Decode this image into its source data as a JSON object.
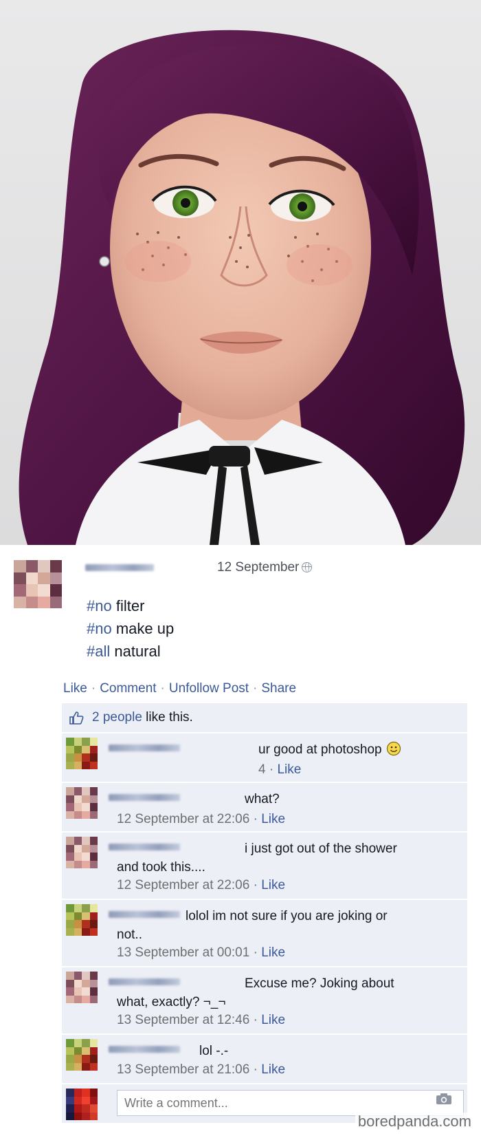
{
  "post": {
    "timestamp": "12 September",
    "lines": [
      {
        "tag": "#no",
        "rest": " filter"
      },
      {
        "tag": "#no",
        "rest": " make up"
      },
      {
        "tag": "#all",
        "rest": " natural"
      }
    ],
    "actions": {
      "like": "Like",
      "comment": "Comment",
      "unfollow": "Unfollow Post",
      "share": "Share",
      "separator": "·"
    },
    "likes": {
      "count_text": "2 people",
      "rest": " like this."
    }
  },
  "comments": [
    {
      "text": "ur good at photoshop",
      "meta_prefix": "4 · ",
      "like": "Like",
      "has_smile": true
    },
    {
      "text": "what?",
      "meta_prefix": "12 September at 22:06 · ",
      "like": "Like"
    },
    {
      "text": "i just got out of the shower",
      "text2": "and took this....",
      "meta_prefix": "12 September at 22:06 · ",
      "like": "Like"
    },
    {
      "text": "lolol im not sure if you are joking or",
      "text2": "not..",
      "meta_prefix": "13 September at 00:01 · ",
      "like": "Like"
    },
    {
      "text": "Excuse me? Joking about",
      "text2": "what, exactly? ¬_¬",
      "meta_prefix": "13 September at 12:46 · ",
      "like": "Like"
    },
    {
      "text": "lol -.-",
      "meta_prefix": "13 September at 21:06 · ",
      "like": "Like"
    }
  ],
  "composer": {
    "placeholder": "Write a comment..."
  },
  "watermark": "boredpanda.com",
  "colors": {
    "link": "#3b5998",
    "ufi_bg": "#eceff5",
    "hair": "#5a1a4a",
    "eyes": "#5a9a2e"
  },
  "icons": [
    "globe-icon",
    "thumbs-up-icon",
    "smile-icon",
    "camera-icon"
  ]
}
